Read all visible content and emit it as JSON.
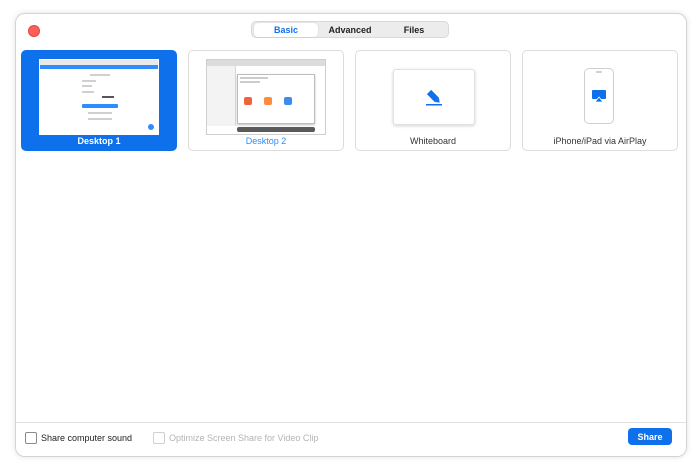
{
  "tabs": [
    {
      "label": "Basic"
    },
    {
      "label": "Advanced"
    },
    {
      "label": "Files"
    }
  ],
  "cards": [
    {
      "label": "Desktop 1",
      "selected": true
    },
    {
      "label": "Desktop 2",
      "selected": false
    },
    {
      "label": "Whiteboard",
      "selected": false
    },
    {
      "label": "iPhone/iPad via AirPlay",
      "selected": false
    }
  ],
  "options": {
    "share_sound_label": "Share computer sound",
    "optimize_label": "Optimize Screen Share for Video Clip"
  },
  "share_button_label": "Share",
  "colors": {
    "accent": "#0e71eb",
    "close": "#ff5f57"
  }
}
